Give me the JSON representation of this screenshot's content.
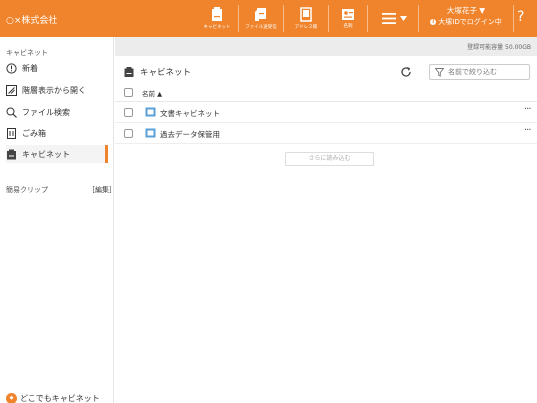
{
  "header": {
    "company": "○×株式会社",
    "nav": [
      {
        "label": "キャビネット",
        "icon": "cabinet-icon"
      },
      {
        "label": "ファイル送受信",
        "icon": "file-transfer-icon"
      },
      {
        "label": "アドレス帳",
        "icon": "address-book-icon"
      },
      {
        "label": "名刺",
        "icon": "business-card-icon"
      }
    ],
    "menu_icon": "hamburger-menu-icon",
    "user_name": "大塚花子 ▼",
    "login_text": "大塚IDでログイン中",
    "help": "?"
  },
  "sidebar": {
    "section_title": "キャビネット",
    "items": [
      {
        "label": "新着",
        "icon": "info-circle-icon"
      },
      {
        "label": "階層表示から開く",
        "icon": "tree-view-icon"
      },
      {
        "label": "ファイル検索",
        "icon": "search-icon"
      },
      {
        "label": "ごみ箱",
        "icon": "trash-icon"
      },
      {
        "label": "キャビネット",
        "icon": "cabinet-icon",
        "active": true
      }
    ],
    "clip_title": "簡易クリップ",
    "clip_edit": "［編集］",
    "anywhere_label": "どこでもキャビネット"
  },
  "main": {
    "capacity": "登録可能容量 50.00GB",
    "location_label": "キャビネット",
    "filter_placeholder": "名前で絞り込む",
    "column_name": "名前 ▲",
    "rows": [
      {
        "name": "文書キャビネット"
      },
      {
        "name": "過去データ保管用"
      }
    ],
    "more_glyph": "···",
    "load_more": "さらに読み込む"
  },
  "colors": {
    "brand": "#f0842c",
    "folder": "#5aa0d8",
    "capacity_bar": "#ececec"
  }
}
